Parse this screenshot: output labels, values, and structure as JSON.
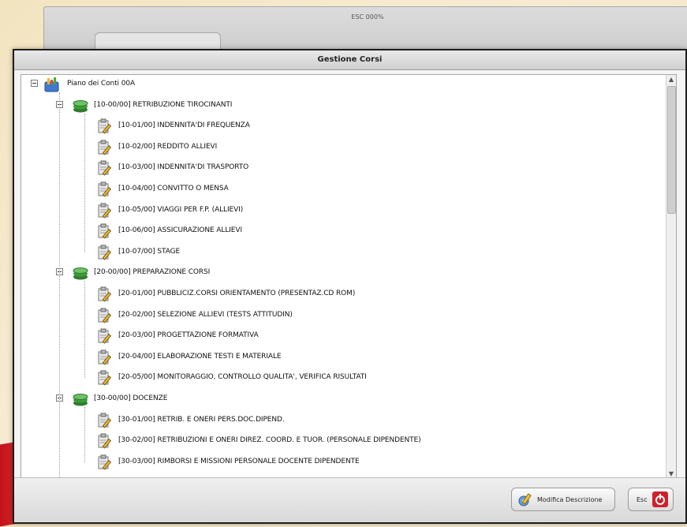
{
  "background_window": {
    "title": "ESC 000%"
  },
  "dialog": {
    "title": "Gestione Corsi"
  },
  "tree": {
    "root": {
      "label": "Piano dei Conti 00A"
    },
    "groups": [
      {
        "label": "[10-00/00] RETRIBUZIONE TIROCINANTI",
        "items": [
          "[10-01/00] INDENNITA'DI FREQUENZA",
          "[10-02/00] REDDITO ALLIEVI",
          "[10-03/00] INDENNITA'DI TRASPORTO",
          "[10-04/00] CONVITTO O MENSA",
          "[10-05/00] VIAGGI PER F.P. (ALLIEVI)",
          "[10-06/00] ASSICURAZIONE ALLIEVI",
          "[10-07/00] STAGE"
        ]
      },
      {
        "label": "[20-00/00] PREPARAZIONE CORSI",
        "items": [
          "[20-01/00] PUBBLICIZ.CORSI ORIENTAMENTO (PRESENTAZ.CD ROM)",
          "[20-02/00] SELEZIONE ALLIEVI (TESTS ATTITUDIN)",
          "[20-03/00] PROGETTAZIONE FORMATIVA",
          "[20-04/00] ELABORAZIONE TESTI E MATERIALE",
          "[20-05/00] MONITORAGGIO, CONTROLLO QUALITA', VERIFICA RISULTATI"
        ]
      },
      {
        "label": "[30-00/00] DOCENZE",
        "items": [
          "[30-01/00] RETRIB. E ONERI PERS.DOC.DIPEND.",
          "[30-02/00] RETRIBUZIONI E ONERI DIREZ. COORD. E TUOR. (PERSONALE DIPENDENTE)",
          "[30-03/00] RIMBORSI E MISSIONI PERSONALE DOCENTE DIPENDENTE"
        ]
      }
    ]
  },
  "buttons": {
    "modify": "Modifica Descrizione",
    "exit": "Esc"
  },
  "colors": {
    "accent_green": "#3f9a3b",
    "exit_red": "#d0202a"
  },
  "icons": {
    "root": "chart-folder-icon",
    "group": "stack-green-icon",
    "item": "document-pencil-icon",
    "exit": "power-icon",
    "modify": "edit-gear-icon"
  }
}
